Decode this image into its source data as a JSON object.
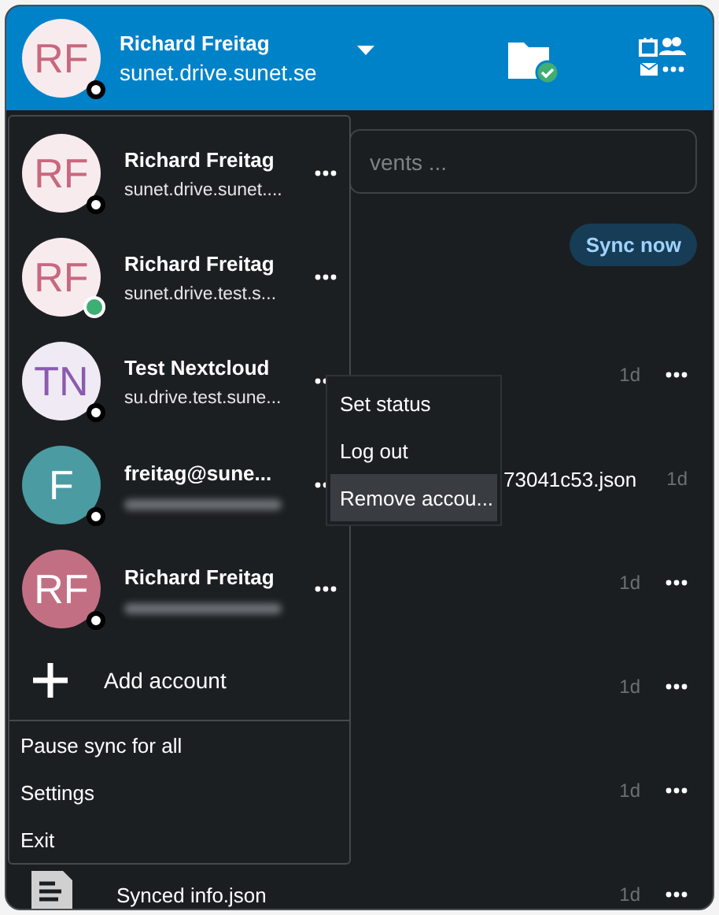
{
  "header": {
    "name": "Richard Freitag",
    "server": "sunet.drive.sunet.se",
    "avatar": {
      "initials": "RF",
      "kind": "light",
      "color": "#c8687f"
    },
    "online": false,
    "sync_ok": true
  },
  "search": {
    "placeholder": "vents ..."
  },
  "sync_button": "Sync now",
  "activities": [
    {
      "kind": "hidden",
      "time": "1d",
      "menu": true
    },
    {
      "kind": "partial",
      "text": "73041c53.json",
      "time": "1d",
      "menu": false
    },
    {
      "kind": "hidden",
      "time": "1d",
      "menu": true
    },
    {
      "kind": "hidden",
      "time": "1d",
      "menu": true
    },
    {
      "kind": "hidden",
      "time": "1d",
      "menu": true
    },
    {
      "kind": "file",
      "text": "Synced info.json",
      "time": "1d",
      "menu": true
    }
  ],
  "accounts": [
    {
      "name": "Richard Freitag",
      "server": "sunet.drive.sunet....",
      "server_blurred": false,
      "avatar": {
        "initials": "RF",
        "kind": "light",
        "color": "#c8687f"
      },
      "online": false
    },
    {
      "name": "Richard Freitag",
      "server": "sunet.drive.test.s...",
      "server_blurred": false,
      "avatar": {
        "initials": "RF",
        "kind": "light",
        "color": "#c8687f"
      },
      "online": true
    },
    {
      "name": "Test Nextcloud",
      "server": "su.drive.test.sune...",
      "server_blurred": false,
      "avatar": {
        "initials": "TN",
        "kind": "light",
        "color": "#8a5bb0"
      },
      "online": false
    },
    {
      "name": "freitag@sune...",
      "server_blurred": true,
      "avatar": {
        "initials": "F",
        "kind": "solid",
        "color": "#4b9ba3"
      },
      "online": false
    },
    {
      "name": "Richard Freitag",
      "server_blurred": true,
      "avatar": {
        "initials": "RF",
        "kind": "solid",
        "color": "#c36f83"
      },
      "online": false
    }
  ],
  "add_account": "Add account",
  "menu_footer": [
    "Pause sync for all",
    "Settings",
    "Exit"
  ],
  "account_submenu": [
    {
      "label": "Set status",
      "selected": false
    },
    {
      "label": "Log out",
      "selected": false
    },
    {
      "label": "Remove accou...",
      "selected": true
    }
  ]
}
